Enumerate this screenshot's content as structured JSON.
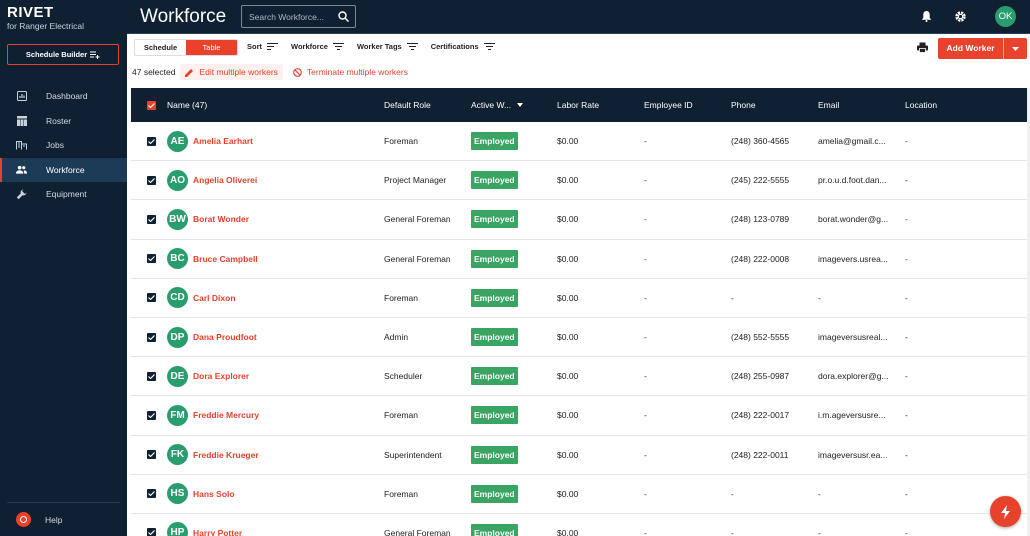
{
  "brand": {
    "name": "RIVET",
    "subtitle": "for Ranger Electrical"
  },
  "sidebar": {
    "schedule_builder": "Schedule Builder",
    "items": [
      {
        "label": "Dashboard",
        "icon": "dashboard-icon"
      },
      {
        "label": "Roster",
        "icon": "roster-icon"
      },
      {
        "label": "Jobs",
        "icon": "jobs-icon"
      },
      {
        "label": "Workforce",
        "icon": "workforce-icon",
        "active": true
      },
      {
        "label": "Equipment",
        "icon": "wrench-icon"
      }
    ],
    "help": "Help"
  },
  "header": {
    "title": "Workforce",
    "search_placeholder": "Search Workforce...",
    "avatar_initials": "OK"
  },
  "toolbar": {
    "view_schedule": "Schedule",
    "view_table": "Table",
    "filters": [
      "Sort",
      "Workforce",
      "Worker Tags",
      "Certifications"
    ],
    "add_worker": "Add Worker",
    "selected_count": "47 selected",
    "edit_multiple": "Edit multiple workers",
    "terminate_multiple": "Terminate multiple workers"
  },
  "table": {
    "columns": [
      "Name (47)",
      "Default Role",
      "Active W...",
      "Labor Rate",
      "Employee ID",
      "Phone",
      "Email",
      "Location"
    ],
    "rows": [
      {
        "initials": "AE",
        "name": "Amelia Earhart",
        "role": "Foreman",
        "status": "Employed",
        "rate": "$0.00",
        "emp_id": "-",
        "phone": "(248) 360-4565",
        "email": "amelia@gmail.c...",
        "location": "-"
      },
      {
        "initials": "AO",
        "name": "Angelia Oliverei",
        "role": "Project Manager",
        "status": "Employed",
        "rate": "$0.00",
        "emp_id": "-",
        "phone": "(245) 222-5555",
        "email": "pr.o.u.d.foot.dan...",
        "location": "-"
      },
      {
        "initials": "BW",
        "name": "Borat Wonder",
        "role": "General Foreman",
        "status": "Employed",
        "rate": "$0.00",
        "emp_id": "-",
        "phone": "(248) 123-0789",
        "email": "borat.wonder@g...",
        "location": "-"
      },
      {
        "initials": "BC",
        "name": "Bruce Campbell",
        "role": "General Foreman",
        "status": "Employed",
        "rate": "$0.00",
        "emp_id": "-",
        "phone": "(248) 222-0008",
        "email": "imagevers.usrea...",
        "location": "-"
      },
      {
        "initials": "CD",
        "name": "Carl Dixon",
        "role": "Foreman",
        "status": "Employed",
        "rate": "$0.00",
        "emp_id": "-",
        "phone": "-",
        "email": "-",
        "location": "-"
      },
      {
        "initials": "DP",
        "name": "Dana Proudfoot",
        "role": "Admin",
        "status": "Employed",
        "rate": "$0.00",
        "emp_id": "-",
        "phone": "(248) 552-5555",
        "email": "imageversusreal...",
        "location": "-"
      },
      {
        "initials": "DE",
        "name": "Dora Explorer",
        "role": "Scheduler",
        "status": "Employed",
        "rate": "$0.00",
        "emp_id": "-",
        "phone": "(248) 255-0987",
        "email": "dora.explorer@g...",
        "location": "-"
      },
      {
        "initials": "FM",
        "name": "Freddie Mercury",
        "role": "Foreman",
        "status": "Employed",
        "rate": "$0.00",
        "emp_id": "-",
        "phone": "(248) 222-0017",
        "email": "i.m.ageversusre...",
        "location": "-"
      },
      {
        "initials": "FK",
        "name": "Freddie Krueger",
        "role": "Superintendent",
        "status": "Employed",
        "rate": "$0.00",
        "emp_id": "-",
        "phone": "(248) 222-0011",
        "email": "imageversusr.ea...",
        "location": "-"
      },
      {
        "initials": "HS",
        "name": "Hans Solo",
        "role": "Foreman",
        "status": "Employed",
        "rate": "$0.00",
        "emp_id": "-",
        "phone": "-",
        "email": "-",
        "location": "-"
      },
      {
        "initials": "HP",
        "name": "Harry Potter",
        "role": "General Foreman",
        "status": "Employed",
        "rate": "$0.00",
        "emp_id": "-",
        "phone": "-",
        "email": "-",
        "location": "-"
      }
    ]
  },
  "colors": {
    "accent": "#e8412c",
    "navy": "#0f2032",
    "avatar": "#2a9d6e",
    "employed": "#3aa562"
  }
}
